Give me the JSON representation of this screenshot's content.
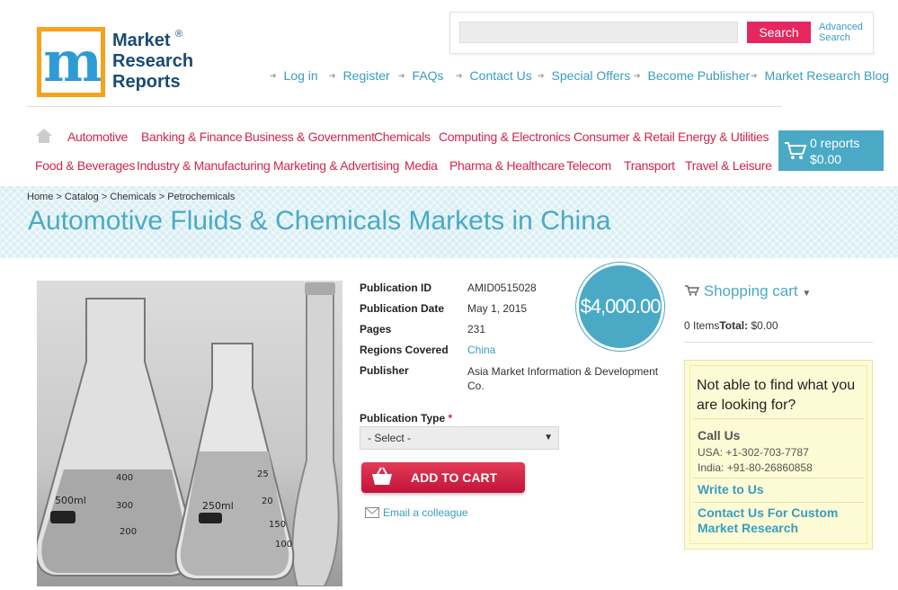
{
  "logo": {
    "line1": "Market",
    "line2": "Research",
    "line3": "Reports",
    "mark": "m",
    "reg": "®"
  },
  "search": {
    "placeholder": "",
    "button": "Search",
    "advanced": "Advanced Search"
  },
  "top_nav": [
    "Log in",
    "Register",
    "FAQs",
    "Contact Us",
    "Special Offers",
    "Become Publisher",
    "Market Research Blog"
  ],
  "categories_row1": [
    "Automotive",
    "Banking & Finance",
    "Business & Government",
    "Chemicals",
    "Computing & Electronics",
    "Consumer & Retail",
    "Energy & Utilities"
  ],
  "categories_row2": [
    "Food & Beverages",
    "Industry & Manufacturing",
    "Marketing & Advertising",
    "Media",
    "Pharma & Healthcare",
    "Telecom",
    "Transport",
    "Travel & Leisure"
  ],
  "cart": {
    "reports": "0 reports",
    "amount": "$0.00"
  },
  "breadcrumb": "Home > Catalog > Chemicals > Petrochemicals",
  "title": "Automotive Fluids & Chemicals Markets in China",
  "details": {
    "pub_id_label": "Publication ID",
    "pub_id": "AMID0515028",
    "pub_date_label": "Publication Date",
    "pub_date": "May 1, 2015",
    "pages_label": "Pages",
    "pages": "231",
    "regions_label": "Regions Covered",
    "regions": "China",
    "publisher_label": "Publisher",
    "publisher": "Asia Market Information & Development Co."
  },
  "price": "$4,000.00",
  "pub_type": {
    "label": "Publication Type",
    "required": "*",
    "selected": "- Select -"
  },
  "add_to_cart": "ADD TO CART",
  "email_colleague": "Email a colleague",
  "shopping_cart": {
    "title": "Shopping cart",
    "items": "0 Items",
    "total_label": "Total:",
    "total": "$0.00"
  },
  "help": {
    "title": "Not able to find what you are looking for?",
    "call_us": "Call Us",
    "usa": "USA: +1-302-703-7787",
    "india": "India: +91-80-26860858",
    "write_us": "Write to Us",
    "custom": "Contact Us For Custom Market Research"
  },
  "colors": {
    "accent": "#4aaac6",
    "brand_red": "#d02550",
    "logo_orange": "#f6a31b",
    "logo_navy": "#1a4a73"
  },
  "image_labels": {
    "flask1": "500ml",
    "flask2": "250ml",
    "s400": "400",
    "s300": "300",
    "s200": "200",
    "s25": "25",
    "s20": "20",
    "s150": "150",
    "s100": "100"
  }
}
